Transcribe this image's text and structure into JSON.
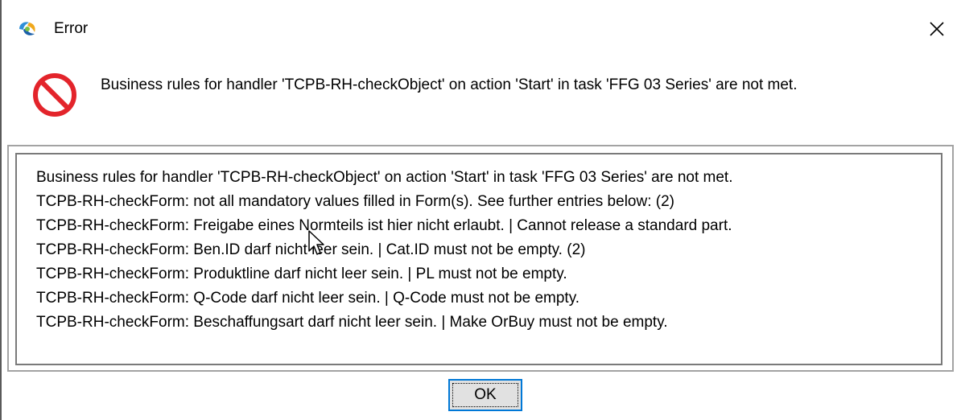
{
  "window": {
    "title": "Error",
    "app_icon": "app-logo-icon",
    "close_icon": "close-icon"
  },
  "message": {
    "icon": "error-stop-icon",
    "text": "Business rules for handler 'TCPB-RH-checkObject' on action 'Start' in task 'FFG 03 Series' are not met."
  },
  "details": {
    "lines": [
      "Business rules for handler 'TCPB-RH-checkObject' on action 'Start' in task 'FFG 03 Series' are not met.",
      "TCPB-RH-checkForm: not all mandatory values filled in Form(s). See further entries below: (2)",
      "TCPB-RH-checkForm: Freigabe eines Normteils ist hier nicht erlaubt. | Cannot release a standard part.",
      "TCPB-RH-checkForm: Ben.ID darf nicht leer sein. | Cat.ID must not be empty. (2)",
      "TCPB-RH-checkForm: Produktline darf nicht leer sein. | PL must not be empty.",
      "TCPB-RH-checkForm: Q-Code darf nicht leer sein. | Q-Code must not be empty.",
      "TCPB-RH-checkForm: Beschaffungsart darf nicht leer sein. | Make OrBuy must not be empty."
    ]
  },
  "buttons": {
    "ok_label": "OK"
  },
  "colors": {
    "error_red": "#e3242b",
    "focus_blue": "#0078d7"
  }
}
